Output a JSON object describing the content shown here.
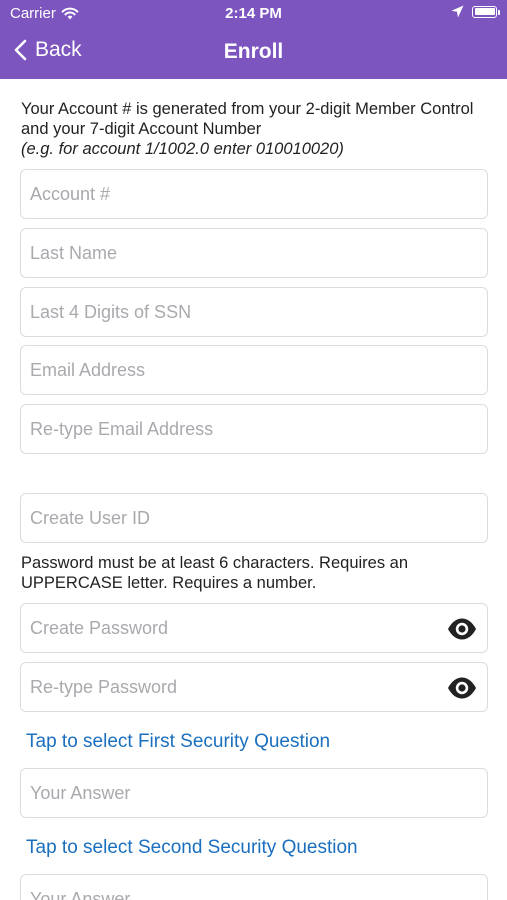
{
  "status_bar": {
    "carrier": "Carrier",
    "time": "2:14 PM"
  },
  "nav": {
    "back_label": "Back",
    "title": "Enroll"
  },
  "intro": {
    "text": "Your Account # is generated from your 2-digit Member Control and your 7-digit Account Number",
    "example": "(e.g. for account 1/1002.0 enter 010010020)"
  },
  "fields": {
    "account": {
      "placeholder": "Account #",
      "value": ""
    },
    "last_name": {
      "placeholder": "Last Name",
      "value": ""
    },
    "ssn_last4": {
      "placeholder": "Last 4 Digits of SSN",
      "value": ""
    },
    "email": {
      "placeholder": "Email Address",
      "value": ""
    },
    "email_confirm": {
      "placeholder": "Re-type Email Address",
      "value": ""
    },
    "user_id": {
      "placeholder": "Create User ID",
      "value": ""
    },
    "password": {
      "placeholder": "Create Password",
      "value": ""
    },
    "password_confirm": {
      "placeholder": "Re-type Password",
      "value": ""
    },
    "answer1": {
      "placeholder": "Your Answer",
      "value": ""
    },
    "answer2": {
      "placeholder": "Your Answer",
      "value": ""
    }
  },
  "password_note": "Password must be at least 6 characters. Requires an UPPERCASE letter. Requires a number.",
  "security": {
    "first_link": "Tap to select First Security Question",
    "second_link": "Tap to select Second Security Question"
  },
  "colors": {
    "header": "#7d55bf",
    "link": "#1a6fbf",
    "border": "#dcdce0",
    "placeholder": "#a9a9ae"
  }
}
